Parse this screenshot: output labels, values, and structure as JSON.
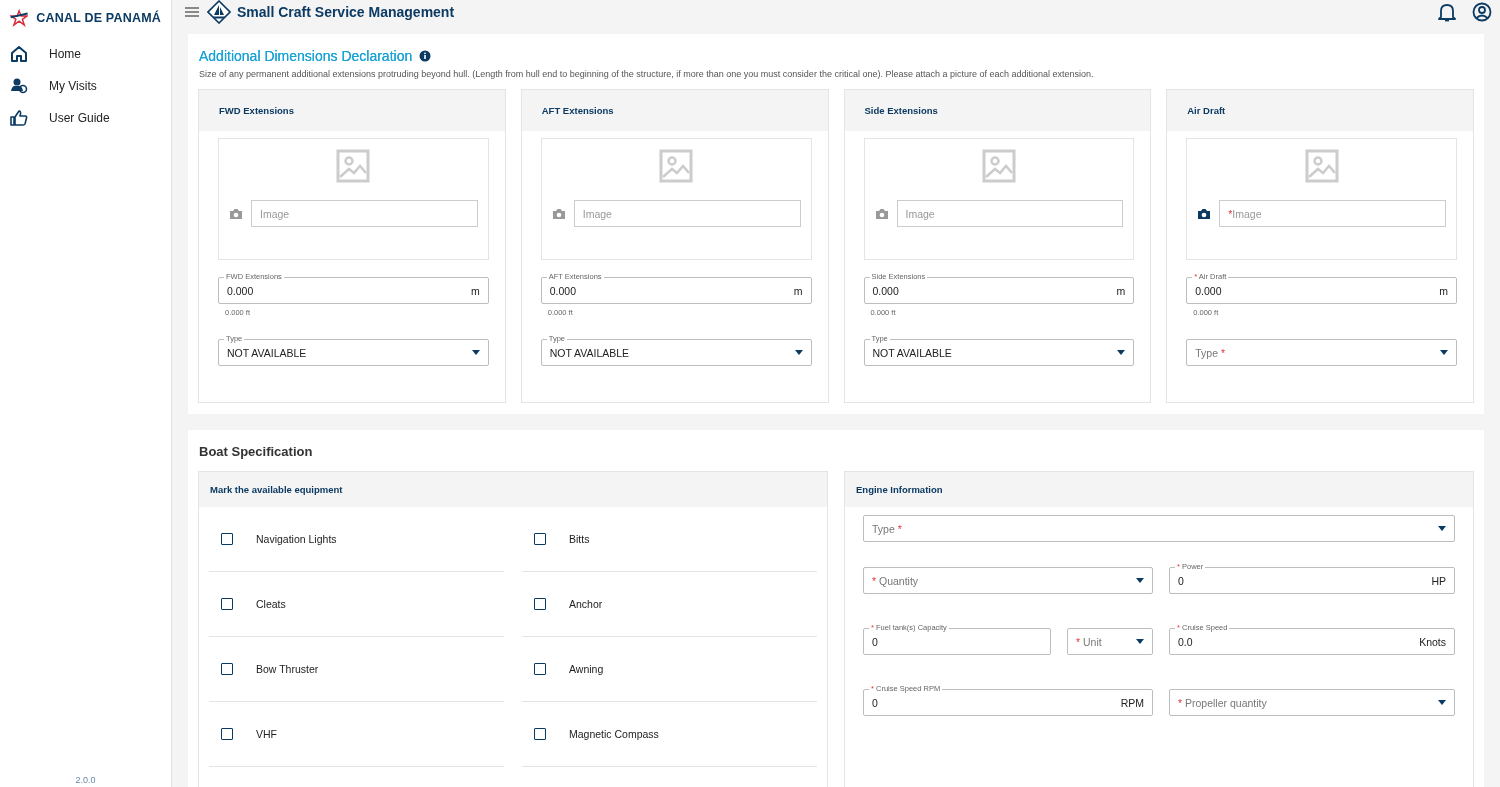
{
  "sidebar": {
    "brand": "CANAL DE PANAMÁ",
    "items": [
      {
        "label": "Home",
        "selected": false
      },
      {
        "label": "My Visits",
        "selected": false
      },
      {
        "label": "User Guide",
        "selected": false
      }
    ],
    "version": "2.0.0"
  },
  "header": {
    "title": "Small Craft Service Management"
  },
  "dimensions": {
    "title": "Additional Dimensions Declaration",
    "description": "Size of any permanent additional extensions protruding beyond hull. (Length from hull end to beginning of the structure, if more than one you must consider the critical one). Please attach a picture of each additional extension.",
    "extensions": [
      {
        "title": "FWD Extensions",
        "image": {
          "placeholder": "Image"
        },
        "length": {
          "label": "FWD Extensions",
          "value": "0.000",
          "unit": "m",
          "hint": "0.000 ft"
        },
        "type": {
          "label": "Type",
          "value": "NOT AVAILABLE"
        }
      },
      {
        "title": "AFT Extensions",
        "image": {
          "placeholder": "Image"
        },
        "length": {
          "label": "AFT Extensions",
          "value": "0.000",
          "unit": "m",
          "hint": "0.000 ft"
        },
        "type": {
          "label": "Type",
          "value": "NOT AVAILABLE"
        }
      },
      {
        "title": "Side Extensions",
        "image": {
          "placeholder": "Image"
        },
        "length": {
          "label": "Side Extensions",
          "value": "0.000",
          "unit": "m",
          "hint": "0.000 ft"
        },
        "type": {
          "label": "Type",
          "value": "NOT AVAILABLE"
        }
      },
      {
        "title": "Air Draft",
        "image": {
          "placeholder": "Image",
          "required_mark": "*"
        },
        "length": {
          "label": "Air Draft",
          "required_mark": "*",
          "value": "0.000",
          "unit": "m",
          "hint": "0.000 ft"
        },
        "type": {
          "label": "Type",
          "required_mark": "*"
        }
      }
    ]
  },
  "boat_spec": {
    "title": "Boat Specification",
    "equipment": {
      "title": "Mark the available equipment",
      "items": [
        {
          "label": "Navigation Lights",
          "checked": false
        },
        {
          "label": "Bitts",
          "checked": false
        },
        {
          "label": "Cleats",
          "checked": false
        },
        {
          "label": "Anchor",
          "checked": false
        },
        {
          "label": "Bow Thruster",
          "checked": false
        },
        {
          "label": "Awning",
          "checked": false
        },
        {
          "label": "VHF",
          "checked": false
        },
        {
          "label": "Magnetic Compass",
          "checked": false
        }
      ]
    },
    "engine": {
      "title": "Engine Information",
      "rows": [
        [
          {
            "kind": "select",
            "label": "Type",
            "required_mark": "*"
          }
        ],
        [
          {
            "kind": "select",
            "label": "Quantity",
            "required_mark": "*"
          },
          {
            "kind": "text",
            "label": "Power",
            "required_mark": "*",
            "value": "0",
            "unit": "HP"
          }
        ],
        [
          {
            "kind": "text",
            "label": "Fuel tank(s) Capacity",
            "required_mark": "*",
            "value": "0"
          },
          {
            "kind": "select",
            "label": "Unit",
            "required_mark": "*"
          },
          {
            "kind": "text",
            "label": "Cruise Speed",
            "required_mark": "*",
            "value": "0.0",
            "unit": "Knots"
          }
        ],
        [
          {
            "kind": "text",
            "label": "Cruise Speed RPM",
            "required_mark": "*",
            "value": "0",
            "unit": "RPM"
          },
          {
            "kind": "select",
            "label": "Propeller quantity",
            "required_mark": "*"
          }
        ]
      ]
    }
  }
}
